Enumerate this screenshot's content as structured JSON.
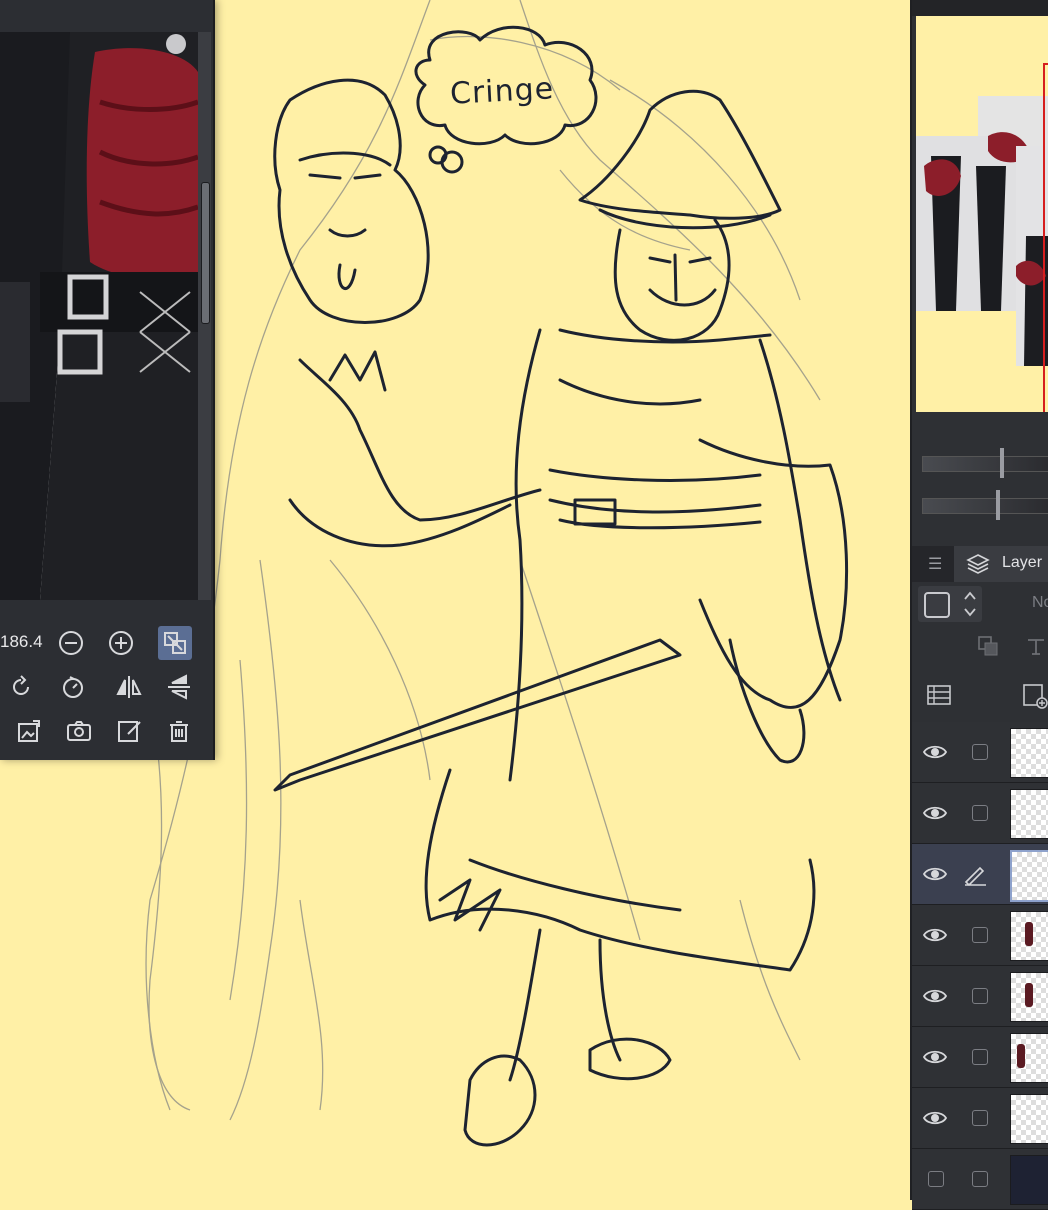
{
  "canvas": {
    "background_color": "#fff0a6",
    "thought_bubble_text": "Cringe"
  },
  "sub_view": {
    "zoom_value": "186.4",
    "tools_row1": [
      "zoom-out-icon",
      "zoom-in-icon",
      "fit-view-icon"
    ],
    "tools_row2": [
      "rotate-icon",
      "rotate-reset-icon",
      "flip-horizontal-icon",
      "flip-vertical-icon"
    ],
    "tools_row3": [
      "import-image-icon",
      "camera-icon",
      "edit-icon",
      "delete-icon"
    ]
  },
  "layer_panel": {
    "tab_label": "Layer",
    "blend_mode": "No",
    "layers": [
      {
        "visible": true,
        "editing": false,
        "thumbnail": "transparent"
      },
      {
        "visible": true,
        "editing": false,
        "thumbnail": "transparent"
      },
      {
        "visible": true,
        "editing": true,
        "thumbnail": "sketch"
      },
      {
        "visible": true,
        "editing": false,
        "thumbnail": "reference-figure"
      },
      {
        "visible": true,
        "editing": false,
        "thumbnail": "reference-figure"
      },
      {
        "visible": true,
        "editing": false,
        "thumbnail": "reference-figure"
      },
      {
        "visible": true,
        "editing": false,
        "thumbnail": "transparent"
      },
      {
        "visible": false,
        "editing": false,
        "thumbnail": "dark-reference"
      }
    ]
  },
  "colors": {
    "panel_bg": "#2e3034",
    "accent_active": "#5b6e94",
    "sketch_ink": "#1d2330",
    "reference_red": "#8c1e2a"
  }
}
